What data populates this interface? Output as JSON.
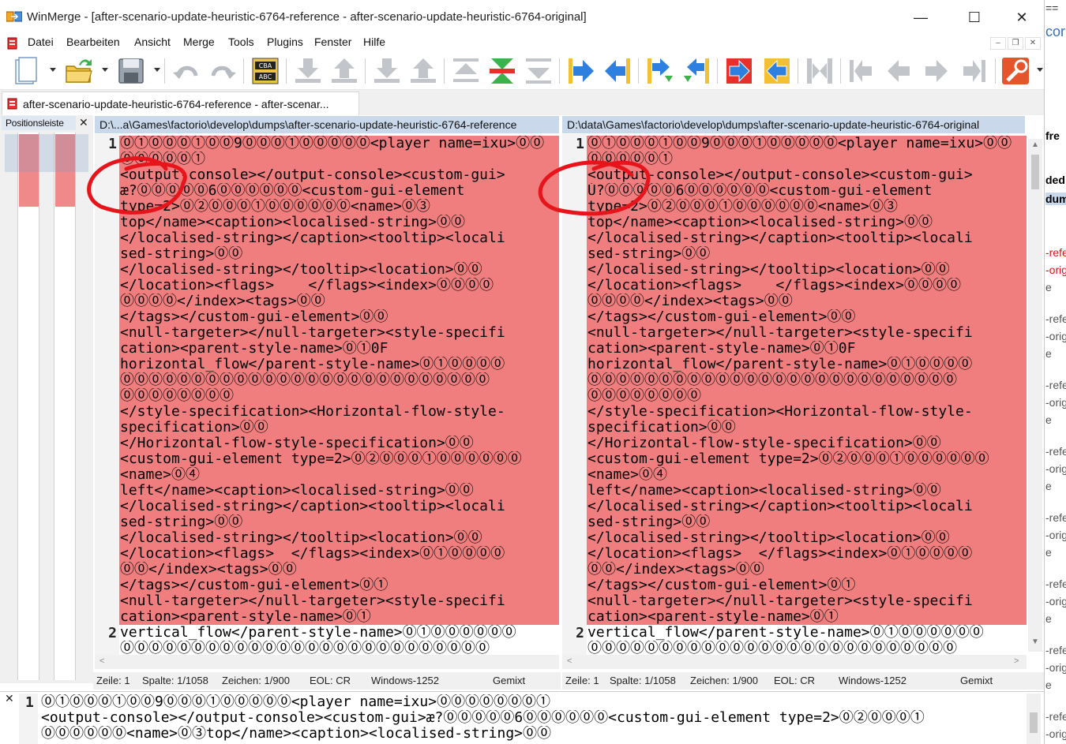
{
  "window": {
    "title": "WinMerge - [after-scenario-update-heuristic-6764-reference - after-scenario-update-heuristic-6764-original]",
    "minimize": "—",
    "maximize": "☐",
    "close": "✕"
  },
  "menu": {
    "items": [
      "Datei",
      "Bearbeiten",
      "Ansicht",
      "Merge",
      "Tools",
      "Plugins",
      "Fenster",
      "Hilfe"
    ],
    "mdi_minimize": "–",
    "mdi_restore": "❐",
    "mdi_close": "✕"
  },
  "toolbar": {
    "buttons": [
      "new-document",
      "open-folder",
      "save",
      "undo",
      "redo",
      "compare-text",
      "next-diff-down",
      "prev-diff-up",
      "last-diff",
      "first-diff",
      "current-diff",
      "next-conflict",
      "prev-conflict",
      "copy-right",
      "copy-left",
      "copy-right-advance",
      "copy-left-advance",
      "copy-all-right",
      "copy-all-left",
      "merge-all",
      "first-line",
      "prev-line",
      "next-line",
      "last-line",
      "options"
    ]
  },
  "doctab": {
    "label": "after-scenario-update-heuristic-6764-reference - after-scenar..."
  },
  "location_pane": {
    "title": "Positionsleiste",
    "close": "✕"
  },
  "left": {
    "path": "D:\\...a\\Games\\factorio\\develop\\dumps\\after-scenario-update-heuristic-6764-reference",
    "line1_num": "1",
    "line2_num": "2",
    "lines": [
      "⓪①⓪⓪⓪①⓪⓪9⓪⓪⓪①⓪⓪⓪⓪⓪<player name=ixu>⓪⓪",
      "⓪⓪⓪⓪⓪①",
      "<output-console></output-console><custom-gui>",
      "æ?⓪⓪⓪⓪⓪6⓪⓪⓪⓪⓪⓪<custom-gui-element",
      "type=2>⓪②⓪⓪⓪①⓪⓪⓪⓪⓪⓪<name>⓪③",
      "top</name><caption><localised-string>⓪⓪",
      "</localised-string></caption><tooltip><locali",
      "sed-string>⓪⓪",
      "</localised-string></tooltip><location>⓪⓪",
      "</location><flags>    </flags><index>⓪⓪⓪⓪",
      "⓪⓪⓪⓪</index><tags>⓪⓪",
      "</tags></custom-gui-element>⓪⓪",
      "<null-targeter></null-targeter><style-specifi",
      "cation><parent-style-name>⓪①0F",
      "horizontal_flow</parent-style-name>⓪①⓪⓪⓪⓪",
      "⓪⓪⓪⓪⓪⓪⓪⓪⓪⓪⓪⓪⓪⓪⓪⓪⓪⓪⓪⓪⓪⓪⓪⓪⓪⓪",
      "⓪⓪⓪⓪⓪⓪⓪⓪",
      "</style-specification><Horizontal-flow-style-",
      "specification>⓪⓪",
      "</Horizontal-flow-style-specification>⓪⓪",
      "<custom-gui-element type=2>⓪②⓪⓪⓪①⓪⓪⓪⓪⓪⓪",
      "<name>⓪④",
      "left</name><caption><localised-string>⓪⓪",
      "</localised-string></caption><tooltip><locali",
      "sed-string>⓪⓪",
      "</localised-string></tooltip><location>⓪⓪",
      "</location><flags>  </flags><index>⓪①⓪⓪⓪⓪",
      "⓪⓪</index><tags>⓪⓪",
      "</tags></custom-gui-element>⓪①",
      "<null-targeter></null-targeter><style-specifi",
      "cation><parent-style-name>⓪①",
      "vertical_flow</parent-style-name>⓪①⓪⓪⓪⓪⓪⓪",
      "⓪⓪⓪⓪⓪⓪⓪⓪⓪⓪⓪⓪⓪⓪⓪⓪⓪⓪⓪⓪⓪⓪⓪⓪⓪⓪"
    ],
    "status": {
      "line": "Zeile: 1",
      "column": "Spalte: 1/1058",
      "chars": "Zeichen: 1/900",
      "eol": "EOL: CR",
      "encoding": "Windows-1252",
      "mode": "Gemixt"
    }
  },
  "right": {
    "path": "D:\\data\\Games\\factorio\\develop\\dumps\\after-scenario-update-heuristic-6764-original",
    "line1_num": "1",
    "line2_num": "2",
    "lines": [
      "⓪①⓪⓪⓪①⓪⓪9⓪⓪⓪①⓪⓪⓪⓪⓪<player name=ixu>⓪⓪",
      "⓪⓪⓪⓪⓪①",
      "<output-console></output-console><custom-gui>",
      "Ú?⓪⓪⓪⓪⓪6⓪⓪⓪⓪⓪⓪<custom-gui-element",
      "type=2>⓪②⓪⓪⓪①⓪⓪⓪⓪⓪⓪<name>⓪③",
      "top</name><caption><localised-string>⓪⓪",
      "</localised-string></caption><tooltip><locali",
      "sed-string>⓪⓪",
      "</localised-string></tooltip><location>⓪⓪",
      "</location><flags>    </flags><index>⓪⓪⓪⓪",
      "⓪⓪⓪⓪</index><tags>⓪⓪",
      "</tags></custom-gui-element>⓪⓪",
      "<null-targeter></null-targeter><style-specifi",
      "cation><parent-style-name>⓪①0F",
      "horizontal_flow</parent-style-name>⓪①⓪⓪⓪⓪",
      "⓪⓪⓪⓪⓪⓪⓪⓪⓪⓪⓪⓪⓪⓪⓪⓪⓪⓪⓪⓪⓪⓪⓪⓪⓪⓪",
      "⓪⓪⓪⓪⓪⓪⓪⓪",
      "</style-specification><Horizontal-flow-style-",
      "specification>⓪⓪",
      "</Horizontal-flow-style-specification>⓪⓪",
      "<custom-gui-element type=2>⓪②⓪⓪⓪①⓪⓪⓪⓪⓪⓪",
      "<name>⓪④",
      "left</name><caption><localised-string>⓪⓪",
      "</localised-string></caption><tooltip><locali",
      "sed-string>⓪⓪",
      "</localised-string></tooltip><location>⓪⓪",
      "</location><flags>  </flags><index>⓪①⓪⓪⓪⓪",
      "⓪⓪</index><tags>⓪⓪",
      "</tags></custom-gui-element>⓪①",
      "<null-targeter></null-targeter><style-specifi",
      "cation><parent-style-name>⓪①",
      "vertical_flow</parent-style-name>⓪①⓪⓪⓪⓪⓪⓪",
      "⓪⓪⓪⓪⓪⓪⓪⓪⓪⓪⓪⓪⓪⓪⓪⓪⓪⓪⓪⓪⓪⓪⓪⓪⓪⓪"
    ],
    "status": {
      "line": "Zeile: 1",
      "column": "Spalte: 1/1058",
      "chars": "Zeichen: 1/900",
      "eol": "EOL: CR",
      "encoding": "Windows-1252",
      "mode": "Gemixt"
    }
  },
  "diff_pane": {
    "close": "✕",
    "line_num": "1",
    "lines": [
      "⓪①⓪⓪⓪①⓪⓪9⓪⓪⓪①⓪⓪⓪⓪⓪<player name=ixu>⓪⓪⓪⓪⓪⓪⓪①",
      "<output-console></output-console><custom-gui>æ?⓪⓪⓪⓪⓪6⓪⓪⓪⓪⓪⓪<custom-gui-element type=2>⓪②⓪⓪⓪①",
      "⓪⓪⓪⓪⓪⓪<name>⓪③top</name><caption><localised-string>⓪⓪"
    ]
  },
  "background_window": {
    "fragments": [
      "==",
      "cor",
      "fre",
      "ded",
      "dum",
      "-refe",
      "-orig",
      "e",
      "-refe",
      "-orig",
      "e",
      "-refe",
      "-orig",
      "e",
      "-refe",
      "-orig",
      "e",
      "-refe",
      "-orig",
      "e",
      "-refe",
      "-orig",
      "e",
      "-refe",
      "-orig",
      "e",
      "-refe",
      "-orig"
    ]
  },
  "colors": {
    "diff": "#f07e7e",
    "header": "#c9d8ea",
    "annotation": "#e8141c"
  }
}
